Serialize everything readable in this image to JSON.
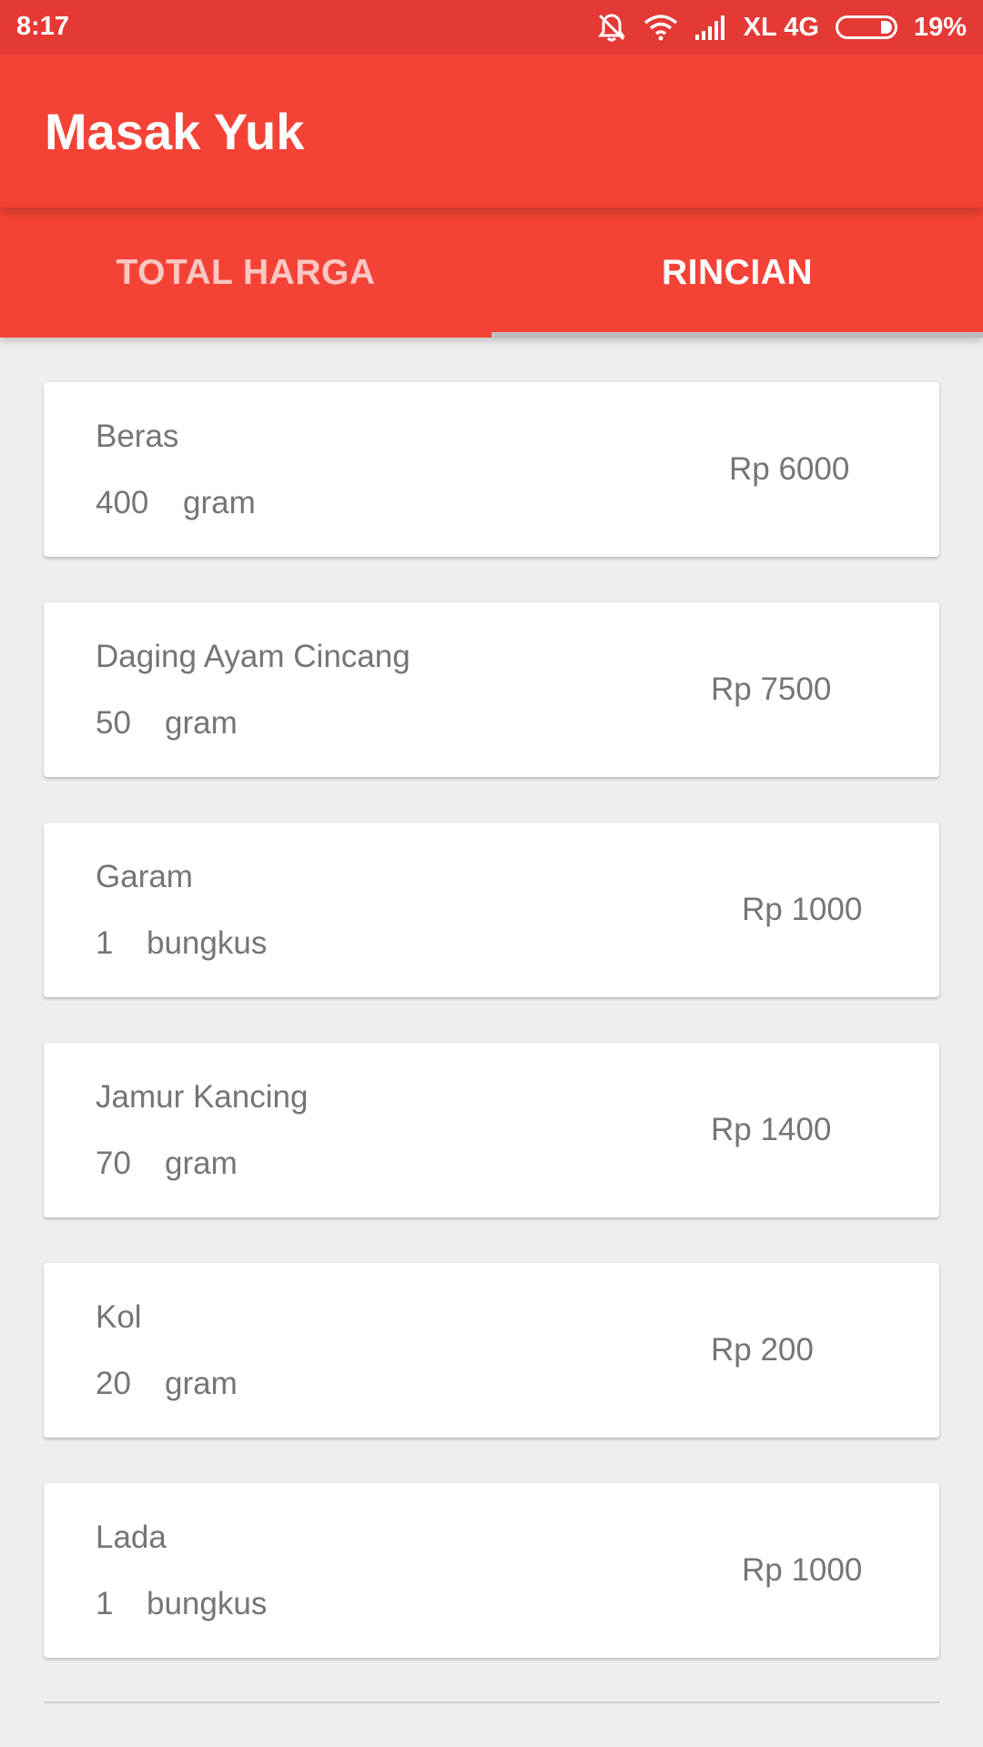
{
  "status_bar": {
    "time": "8:17",
    "carrier": "XL 4G",
    "battery": "19%"
  },
  "app_bar": {
    "title": "Masak Yuk"
  },
  "tabs": [
    {
      "label": "TOTAL HARGA",
      "active": false
    },
    {
      "label": "RINCIAN",
      "active": true
    }
  ],
  "items": [
    {
      "name": "Beras",
      "qty": "400",
      "unit": "gram",
      "price": "Rp 6000"
    },
    {
      "name": "Daging Ayam Cincang",
      "qty": "50",
      "unit": "gram",
      "price": "Rp 7500"
    },
    {
      "name": "Garam",
      "qty": "1",
      "unit": "bungkus",
      "price": "Rp 1000"
    },
    {
      "name": "Jamur Kancing",
      "qty": "70",
      "unit": "gram",
      "price": "Rp 1400"
    },
    {
      "name": "Kol",
      "qty": "20",
      "unit": "gram",
      "price": "Rp 200"
    },
    {
      "name": "Lada",
      "qty": "1",
      "unit": "bungkus",
      "price": "Rp 1000"
    }
  ],
  "colors": {
    "primary": "#f44336",
    "status_bar": "#e53935",
    "background": "#eeeeee",
    "text_secondary": "#757575"
  }
}
